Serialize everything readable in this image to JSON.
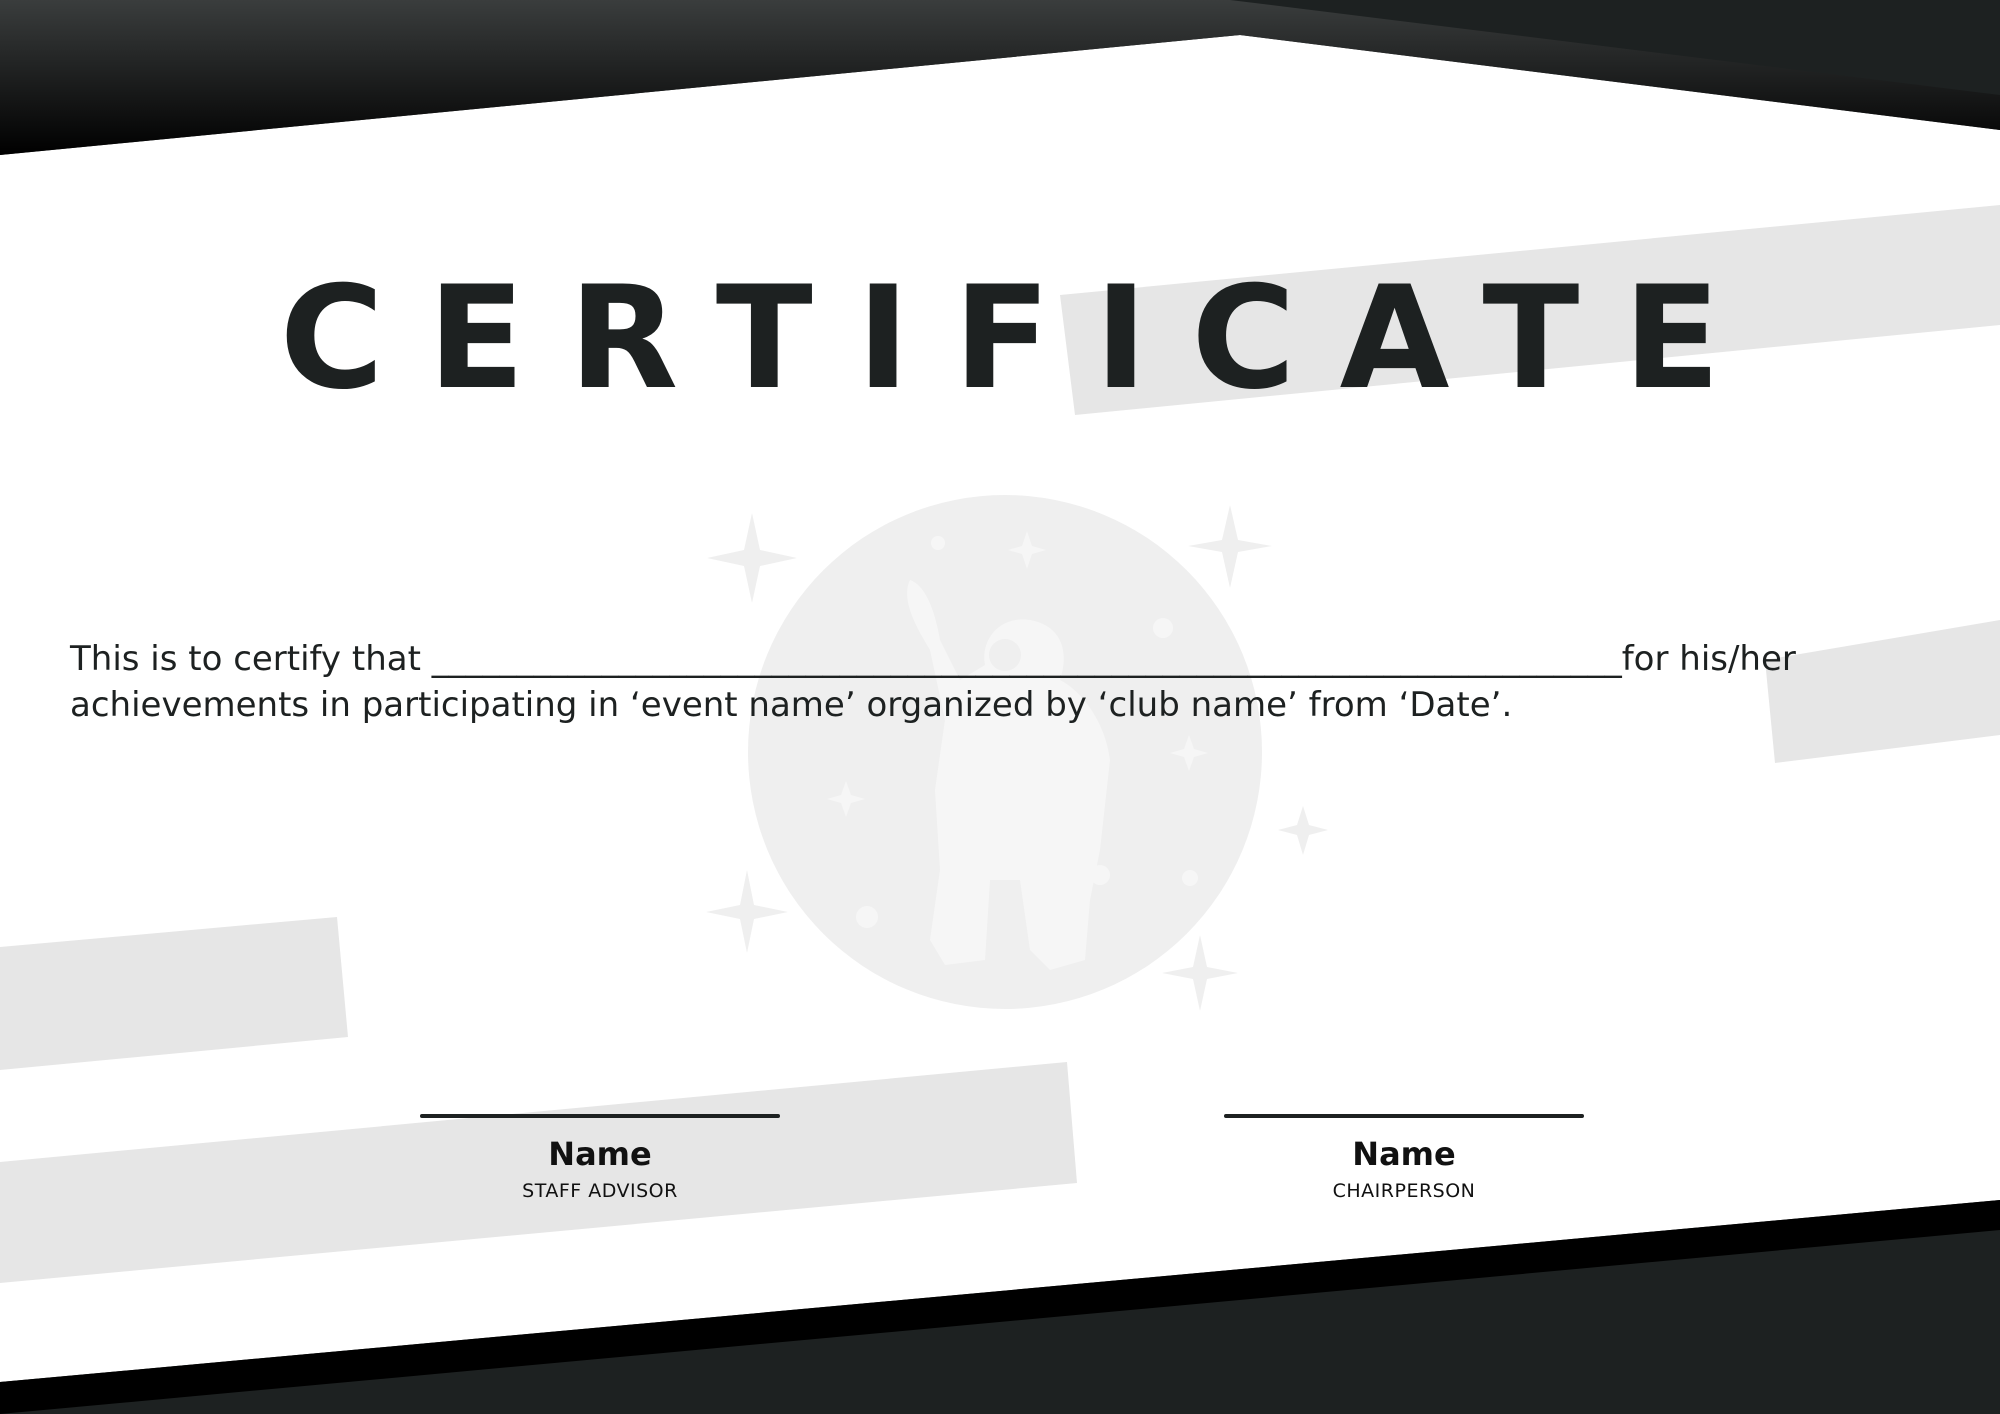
{
  "certificate": {
    "title": "CERTIFICATE",
    "body_line1": "This is to certify that ______________________________________________________________________for his/her",
    "body_line2": "achievements in participating in ‘event name’ organized by ‘club name’ from ‘Date’."
  },
  "signatures": [
    {
      "name": "Name",
      "role": "STAFF ADVISOR"
    },
    {
      "name": "Name",
      "role": "CHAIRPERSON"
    }
  ],
  "colors": {
    "dark": "#1d2121",
    "black": "#000000",
    "band": "#e6e6e6",
    "watermark": "#efefef",
    "background": "#ffffff"
  },
  "icons": {
    "watermark": "astronaut-with-stars-icon"
  }
}
